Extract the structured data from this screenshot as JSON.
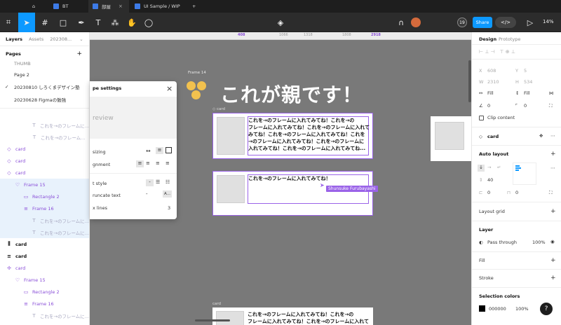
{
  "tabs": [
    {
      "label": "BT",
      "active": false
    },
    {
      "label": "部屋",
      "active": true
    },
    {
      "label": "UI Sample / WIP",
      "active": false
    }
  ],
  "toolbar": {
    "share_label": "Share",
    "code_toggle": "</>",
    "zoom": "14%",
    "user_count": "19"
  },
  "left_panel": {
    "tab_layers": "Layers",
    "tab_assets": "Assets",
    "file_prefix": "202308...",
    "pages_title": "Pages",
    "pages": [
      "THUMB",
      "Page 2",
      "20230810 しろくまデザイン塾",
      "20230628 Figmaの勉強"
    ],
    "current_page_mark": "✓",
    "layers": [
      {
        "label": "これを→のフレームに...",
        "icon": "T",
        "style": "faint",
        "indent": 3
      },
      {
        "label": "これを→のフレーム...",
        "icon": "T",
        "style": "faint",
        "indent": 3
      },
      {
        "label": "card",
        "icon": "◇",
        "style": "purple",
        "indent": 0
      },
      {
        "label": "card",
        "icon": "◇",
        "style": "purple",
        "indent": 0
      },
      {
        "label": "card",
        "icon": "◇",
        "style": "purple",
        "indent": 0
      },
      {
        "label": "Frame 15",
        "icon": "♡",
        "style": "purple",
        "indent": 1
      },
      {
        "label": "Rectangle 2",
        "icon": "▭",
        "style": "purple",
        "indent": 2
      },
      {
        "label": "Frame 16",
        "icon": "≡",
        "style": "purple",
        "indent": 2
      },
      {
        "label": "これを→のフレームに...",
        "icon": "T",
        "style": "faint",
        "indent": 3
      },
      {
        "label": "これを→のフレームに...",
        "icon": "T",
        "style": "faint",
        "indent": 3
      },
      {
        "label": "card",
        "icon": "⫼",
        "style": "bold",
        "indent": 0
      },
      {
        "label": "card",
        "icon": "≡",
        "style": "bold",
        "indent": 0
      },
      {
        "label": "card",
        "icon": "✢",
        "style": "purple",
        "indent": 0
      },
      {
        "label": "Frame 15",
        "icon": "♡",
        "style": "purple",
        "indent": 1
      },
      {
        "label": "Rectangle 2",
        "icon": "▭",
        "style": "purple",
        "indent": 2
      },
      {
        "label": "Frame 16",
        "icon": "≡",
        "style": "purple",
        "indent": 2
      },
      {
        "label": "これを→のフレームに...",
        "icon": "T",
        "style": "faint",
        "indent": 3
      }
    ]
  },
  "canvas": {
    "ruler_marks": [
      "408",
      "1066",
      "1318",
      "1808",
      "2918"
    ],
    "frame_label": "Frame 14",
    "heading": "これが親です！",
    "card_label_1": "card",
    "card_label_2": "card",
    "card1_text": [
      "これを→のフレームに入れてみてね！これを→の",
      "フレームに入れてみてね！これを→のフレームに入れて",
      "みてね！これを→のフレームに入れてみてね！これを",
      "→のフレームに入れてみてね！これを→のフレームに",
      "入れてみてね！これを→のフレームに入れてみてね..."
    ],
    "card2_text": "これを→のフレームに入れてみてね！",
    "card3_text": [
      "これを→のフレームに入れてみてね！これを→の",
      "フレームに入れてみてね！これを→のフレームに入れて"
    ],
    "cursor_user": "Shunsuke Furubayashi",
    "cursor_color": "#9a63e8"
  },
  "popover": {
    "title": "pe settings",
    "preview": "review",
    "sizing_label": "sizing",
    "alignment_label": "gnment",
    "text_style_label": "t style",
    "truncate_label": "runcate text",
    "max_lines_label": "x lines",
    "max_lines_value": "3",
    "close_icon": "×",
    "truncate_value": "A..."
  },
  "right_panel": {
    "tab_design": "Design",
    "tab_prototype": "Prototype",
    "x_label": "X",
    "x_value": "608",
    "y_label": "Y",
    "y_value": "5",
    "w_label": "W",
    "w_value": "2310",
    "h_label": "H",
    "h_value": "534",
    "fill_w": "Fill",
    "fill_h": "Fill",
    "rotation": "0",
    "radius": "0",
    "clip_content": "Clip content",
    "component_name": "card",
    "auto_layout": "Auto layout",
    "spacing": "40",
    "padding_h": "0",
    "padding_v": "0",
    "layout_grid": "Layout grid",
    "layer": "Layer",
    "blend": "Pass through",
    "layer_opacity": "100%",
    "fill": "Fill",
    "stroke": "Stroke",
    "selection_colors": "Selection colors",
    "color_hex": "000000",
    "color_opacity": "100%",
    "help": "?"
  },
  "colors": {
    "accent": "#0d99ff",
    "selection": "#9a63e8",
    "canvas": "#797979"
  }
}
